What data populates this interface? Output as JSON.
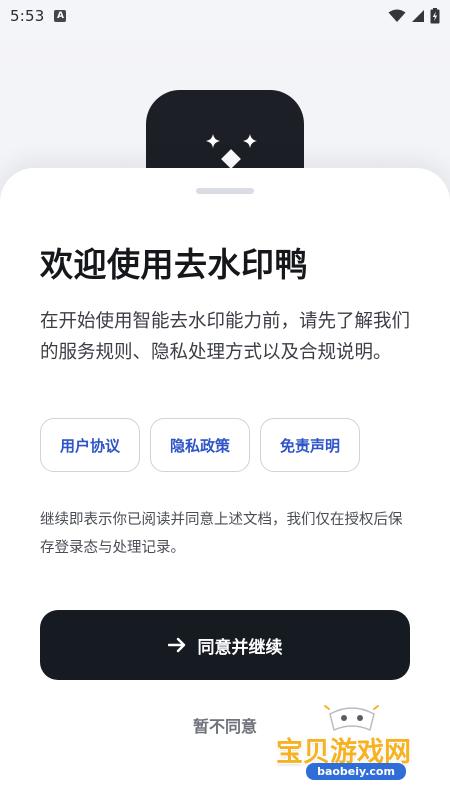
{
  "status_bar": {
    "time": "5:53",
    "notification_icon": "a-icon",
    "icons": [
      "wifi-icon",
      "signal-icon",
      "battery-charging-icon"
    ]
  },
  "app_icon": {
    "name": "sparkle-icon"
  },
  "sheet": {
    "title": "欢迎使用去水印鸭",
    "intro": "在开始使用智能去水印能力前，请先了解我们的服务规则、隐私处理方式以及合规说明。",
    "links": [
      {
        "label": "用户协议"
      },
      {
        "label": "隐私政策"
      },
      {
        "label": "免责声明"
      }
    ],
    "notice": "继续即表示你已阅读并同意上述文档，我们仅在授权后保存登录态与处理记录。",
    "continue_label": "同意并继续",
    "continue_icon": "arrow-right-icon",
    "decline_label": "暂不同意"
  },
  "watermark": {
    "text": "宝贝游戏网",
    "url": "baobeiy.com"
  },
  "colors": {
    "primary_dark": "#161a21",
    "link_blue": "#2e54c7",
    "watermark_yellow": "#f7b224"
  }
}
